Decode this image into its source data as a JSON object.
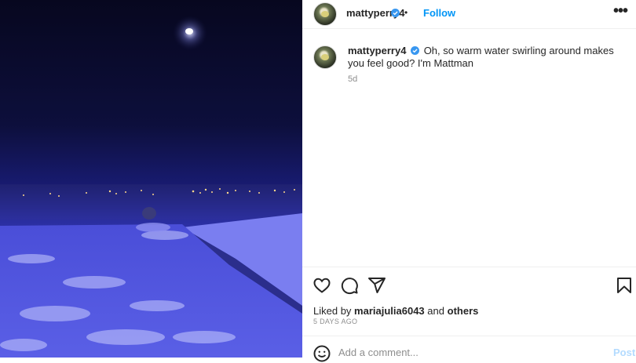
{
  "post": {
    "username": "mattyperry4",
    "verified": true,
    "follow_label": "Follow",
    "separator": "•",
    "more_icon": "more-horizontal-icon"
  },
  "caption": {
    "username": "mattyperry4",
    "text": "Oh, so warm water swirling around makes you feel good? I'm Mattman",
    "time_ago": "5d"
  },
  "actions": {
    "icons": [
      "heart-icon",
      "comment-icon",
      "share-icon",
      "bookmark-icon"
    ]
  },
  "likes": {
    "prefix": "Liked by",
    "user": "mariajulia6043",
    "connector": "and",
    "others": "others"
  },
  "date": "5 DAYS AGO",
  "comment": {
    "placeholder": "Add a comment...",
    "post_label": "Post",
    "emoji_icon": "emoji-icon"
  },
  "colors": {
    "link_blue": "#0095f6",
    "verified_blue": "#3897f0",
    "muted": "#8e8e8e"
  }
}
